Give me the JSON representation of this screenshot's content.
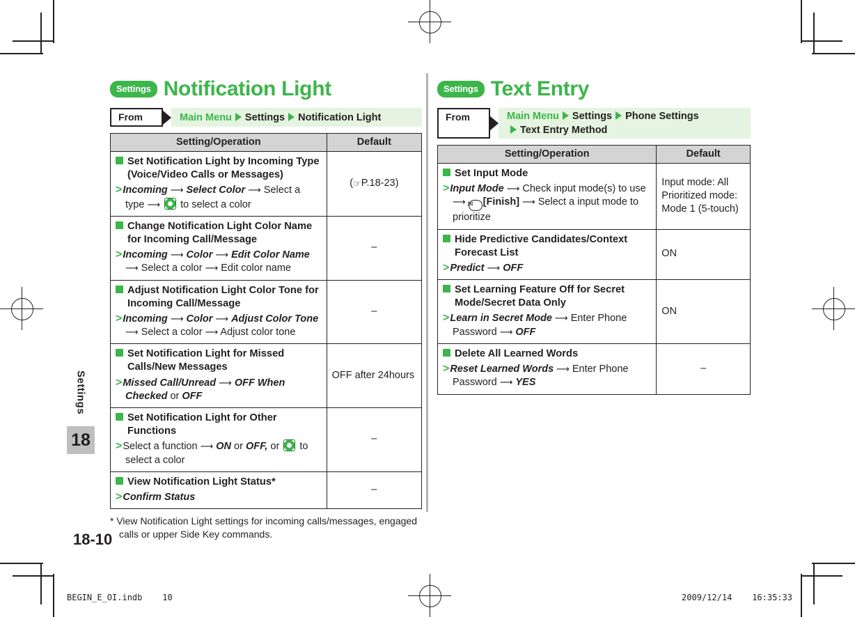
{
  "marks": {
    "registration_icon": "registration-crosshair-icon",
    "crop_icon": "crop-mark"
  },
  "sidetab": {
    "label": "Settings",
    "chapter": "18"
  },
  "page_number": "18-10",
  "footer": {
    "left": "BEGIN_E_OI.indb    10",
    "right": "2009/12/14    16:35:33"
  },
  "colors": {
    "accent": "#3cb54a",
    "path_bg": "#e4f4e0",
    "header_bg": "#d4d4d4",
    "ink": "#231f20"
  },
  "left": {
    "badge": "Settings",
    "title": "Notification Light",
    "from": {
      "button": "From",
      "path_parts": [
        "Main Menu",
        "Settings",
        "Notification Light"
      ]
    },
    "table": {
      "headers": [
        "Setting/Operation",
        "Default"
      ],
      "rows": [
        {
          "item": "Set Notification Light by Incoming Type (Voice/Video Calls or Messages)",
          "op_html": "<span class=\"gt\">&gt;</span><span class=\"bi\">Incoming</span> <span class=\"ar\">&#10230;</span> <span class=\"bi\">Select Color</span> <span class=\"ar\">&#10230;</span> Select a type <span class=\"ar\">&#10230;</span> <span class=\"navkey\"><i class=\"tl\"></i><i class=\"tr\"></i><i class=\"bl\"></i><i class=\"br\"></i></span> to select a color",
          "default": "(☞P.18-23)",
          "default_kind": "ref"
        },
        {
          "item": "Change Notification Light Color Name for Incoming Call/Message",
          "op_html": "<span class=\"gt\">&gt;</span><span class=\"bi\">Incoming</span> <span class=\"ar\">&#10230;</span> <span class=\"bi\">Color</span> <span class=\"ar\">&#10230;</span> <span class=\"bi\">Edit Color Name</span> <span class=\"ar\">&#10230;</span> Select a color <span class=\"ar\">&#10230;</span> Edit color name",
          "default": "–",
          "default_kind": "dash"
        },
        {
          "item": "Adjust Notification Light Color Tone for Incoming Call/Message",
          "op_html": "<span class=\"gt\">&gt;</span><span class=\"bi\">Incoming</span> <span class=\"ar\">&#10230;</span> <span class=\"bi\">Color</span> <span class=\"ar\">&#10230;</span> <span class=\"bi\">Adjust Color Tone</span> <span class=\"ar\">&#10230;</span> Select a color <span class=\"ar\">&#10230;</span> Adjust color tone",
          "default": "–",
          "default_kind": "dash"
        },
        {
          "item": "Set Notification Light for Missed Calls/New Messages",
          "op_html": "<span class=\"gt\">&gt;</span><span class=\"bi\">Missed Call/Unread</span> <span class=\"ar\">&#10230;</span> <span class=\"bi\">OFF When Checked</span> or <span class=\"bi\">OFF</span>",
          "default": "OFF after 24hours",
          "default_kind": "text"
        },
        {
          "item": "Set Notification Light for Other Functions",
          "op_html": "<span class=\"gt\">&gt;</span>Select a function <span class=\"ar\">&#10230;</span> <span class=\"bi\">ON</span> or <span class=\"bi\">OFF,</span> or <span class=\"navkey\"><i class=\"tl\"></i><i class=\"tr\"></i><i class=\"bl\"></i><i class=\"br\"></i></span> to select a color",
          "default": "–",
          "default_kind": "dash"
        },
        {
          "item": "View Notification Light Status*",
          "op_html": "<span class=\"gt\">&gt;</span><span class=\"bi\">Confirm Status</span>",
          "default": "–",
          "default_kind": "dash"
        }
      ]
    },
    "footnote": "* View Notification Light settings for incoming calls/messages, engaged calls or upper Side Key commands."
  },
  "right": {
    "badge": "Settings",
    "title": "Text Entry",
    "from": {
      "button": "From",
      "path_parts": [
        "Main Menu",
        "Settings",
        "Phone Settings",
        "Text Entry Method"
      ]
    },
    "table": {
      "headers": [
        "Setting/Operation",
        "Default"
      ],
      "rows": [
        {
          "item": "Set Input Mode",
          "op_html": "<span class=\"gt\">&gt;</span><span class=\"bi\">Input Mode</span> <span class=\"ar\">&#10230;</span> Check input mode(s) to use <span class=\"ar\">&#10230;</span> <span class=\"mailkey\">&#9993;</span><b>[Finish]</b> <span class=\"ar\">&#10230;</span> Select a input mode to prioritize",
          "default": "Input mode: All Prioritized mode: Mode 1 (5-touch)",
          "default_kind": "text"
        },
        {
          "item": "Hide Predictive Candidates/Context Forecast List",
          "op_html": "<span class=\"gt\">&gt;</span><span class=\"bi\">Predict</span> <span class=\"ar\">&#10230;</span> <span class=\"bi\">OFF</span>",
          "default": "ON",
          "default_kind": "text"
        },
        {
          "item": "Set Learning Feature Off for Secret Mode/Secret Data Only",
          "op_html": "<span class=\"gt\">&gt;</span><span class=\"bi\">Learn in Secret Mode</span> <span class=\"ar\">&#10230;</span> Enter Phone Password <span class=\"ar\">&#10230;</span> <span class=\"bi\">OFF</span>",
          "default": "ON",
          "default_kind": "text"
        },
        {
          "item": "Delete All Learned Words",
          "op_html": "<span class=\"gt\">&gt;</span><span class=\"bi\">Reset Learned Words</span> <span class=\"ar\">&#10230;</span> Enter Phone Password <span class=\"ar\">&#10230;</span> <span class=\"bi\">YES</span>",
          "default": "–",
          "default_kind": "dash"
        }
      ]
    }
  }
}
